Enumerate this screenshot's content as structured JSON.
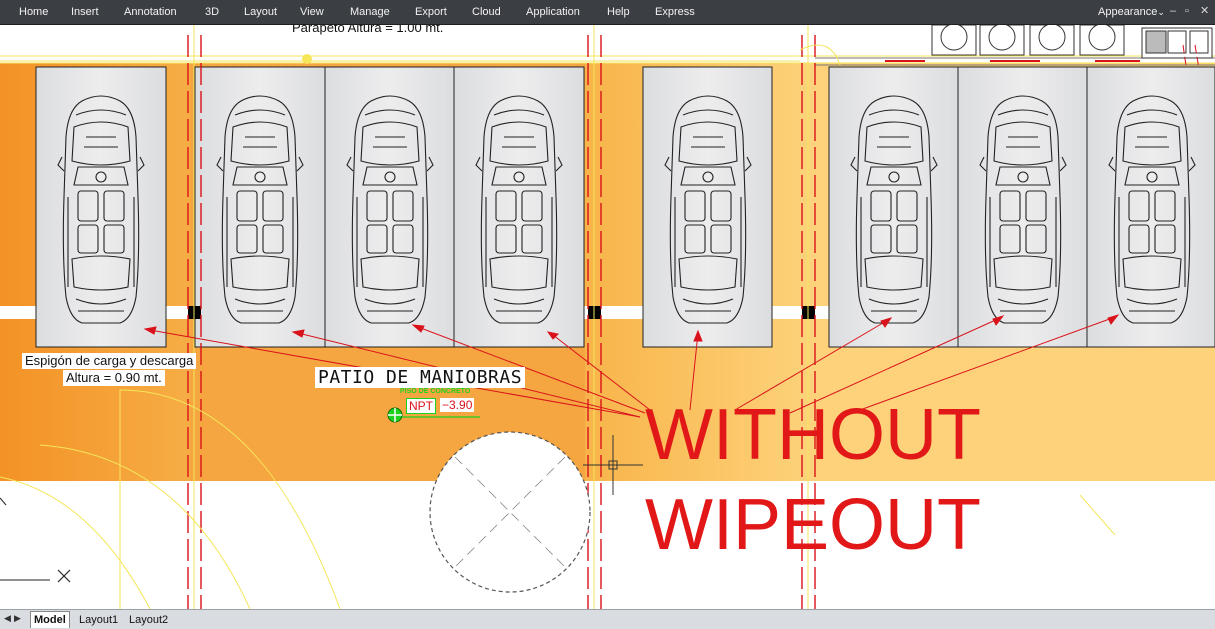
{
  "menu": {
    "items": [
      "Home",
      "Insert",
      "Annotation",
      "3D",
      "Layout",
      "View",
      "Manage",
      "Export",
      "Cloud",
      "Application",
      "Help",
      "Express"
    ],
    "appearance": "Appearance",
    "appearance_arrow": "⌄"
  },
  "drawing": {
    "parapet_label": "Parapeto Altura = 1.00 mt.",
    "dock_label_line1": "Espigón de carga y descarga",
    "dock_label_line2": "Altura = 0.90 mt.",
    "yard_title": "PATIO DE MANIOBRAS",
    "floor_tag": "PISO DE CONCRETO",
    "level_prefix": "NPT",
    "level_value": "−3.90",
    "annotation_line1": "WITHOUT",
    "annotation_line2": "WIPEOUT"
  },
  "tabs": {
    "items": [
      "Model",
      "Layout1",
      "Layout2"
    ],
    "active": "Model"
  },
  "colors": {
    "menubar_bg": "#3b3f44",
    "orange_dark": "#f39a2c",
    "orange_light": "#fdd27a",
    "guide_yellow": "#f5e65a",
    "dashed_red": "#d9121b",
    "annotation_red": "#e21717",
    "parking_fill": "#e6e7e8"
  }
}
